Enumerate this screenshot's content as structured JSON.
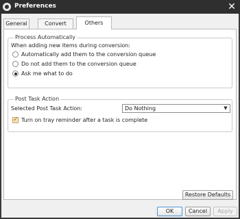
{
  "window": {
    "title": "Preferences",
    "icon": "app-logo-icon",
    "close_icon": "close-icon"
  },
  "tabs": [
    {
      "label": "General",
      "active": false
    },
    {
      "label": "Convert",
      "active": false
    },
    {
      "label": "Others",
      "active": true
    }
  ],
  "process_auto": {
    "title": "Process Automatically",
    "prompt": "When adding new items during conversion:",
    "options": [
      {
        "label": "Automatically add them to the conversion queue",
        "checked": false
      },
      {
        "label": "Do not add them to the conversion queue",
        "checked": false
      },
      {
        "label": "Ask me what to do",
        "checked": true
      }
    ]
  },
  "post_task": {
    "title": "Post Task Action",
    "select_label": "Selected Post Task Action:",
    "select_value": "Do Nothing",
    "tray_reminder": {
      "label": "Turn on tray reminder after a task is complete",
      "checked": true
    }
  },
  "buttons": {
    "restore": "Restore Defaults",
    "ok": "OK",
    "cancel": "Cancel",
    "apply": "Apply"
  },
  "colors": {
    "titlebar": "#2f2f2f",
    "frame": "#3a3a3a",
    "checkbox_accent": "#f7e4b8"
  }
}
